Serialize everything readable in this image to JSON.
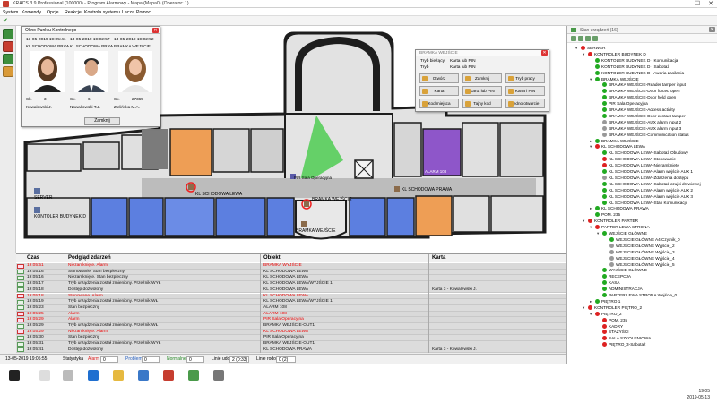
{
  "window": {
    "title": "KRACS 3.9 Professional (100000) - Program Alarmowy - Mapa (Mapa0) (Operator: 1)",
    "controls": [
      "—",
      "☐",
      "✕"
    ]
  },
  "menu": [
    "System",
    "Komendy",
    "Opcje",
    "Reakcje",
    "Kontrola systemu",
    "Lacza",
    "Pomoc"
  ],
  "map": {
    "labels": {
      "server": "SERVER",
      "controller_d": "KONTOLER BUDYNEK D",
      "left_wing": "KL SCHODOWA LEWA",
      "pir": "PIR Sala Operacyjna",
      "gate": "BRAMKA WEJŚCIE",
      "right_wing": "KL SCHODOWA PRAWA",
      "alarm_room": "ALARM 108"
    }
  },
  "checkpoint_window": {
    "title": "Okno Punktu Kontrolnego",
    "close_label": "Zamknij",
    "persons": [
      {
        "date": "13-05-2019 19:05:41",
        "object": "KL SCHODOWA PRAW",
        "sk": "Sk.",
        "sk_num": "3",
        "name": "Kowalewski J."
      },
      {
        "date": "13-05-2019 19:02:57",
        "object": "KL SCHODOWA PRAW",
        "sk": "Sk.",
        "sk_num": "6",
        "name": "Nowakowski T.J."
      },
      {
        "date": "13-05-2019 19:02:52",
        "object": "BRAMKA WEJSCIE",
        "sk": "Sk.",
        "sk_num": "27365",
        "name": "Zielińska M.A."
      }
    ]
  },
  "gate_window": {
    "title": "BRAMKA WEJŚCIE",
    "mode_label": "Tryb bieżący",
    "mode_value": "Karta lub PIN",
    "mode2_label": "Tryb",
    "mode2_value": "Karta lub PIN",
    "buttons": [
      "Otwórz",
      "Zamknij",
      "Tryb pracy",
      "Karta",
      "Karta lub PIN",
      "Karta i PIN",
      "Kod miejsca",
      "Tajny kod",
      "Jedno otwarcie"
    ]
  },
  "events": {
    "columns": {
      "time": "Czas",
      "event": "Podgląd zdarzeń",
      "object": "Obiekt",
      "card": "Karta"
    },
    "rows": [
      {
        "time": "19:05:51",
        "event": "Niezamknięte. Alarm",
        "object": "BRAMKA WYJŚCIE",
        "card": "",
        "kind": "alarm"
      },
      {
        "time": "19:05:16",
        "event": "Stonowanie. Stan bezpieczny",
        "object": "KL SCHODOWA LEWA",
        "card": "",
        "kind": "ok"
      },
      {
        "time": "19:05:16",
        "event": "Niezamknięte. Stan bezpieczny",
        "object": "KL SCHODOWA LEWA",
        "card": "",
        "kind": "ok"
      },
      {
        "time": "19:05:17",
        "event": "Tryb urządzenia został zmieniony. Przeżnik WYŁ",
        "object": "KL SCHODOWA LEWA/WYJŚCIE 1",
        "card": "",
        "kind": "ok"
      },
      {
        "time": "19:05:18",
        "event": "Dostęp dozwolony",
        "object": "KL SCHODOWA LEWA",
        "card": "Karta 3 - Kowalewski J.",
        "kind": "ok"
      },
      {
        "time": "19:05:18",
        "event": "Stonowane. Alarm",
        "object": "KL SCHODOWA LEWA",
        "card": "",
        "kind": "alarm"
      },
      {
        "time": "19:05:19",
        "event": "Tryb urządzenia został zmieniony. Przeżnik WŁ",
        "object": "KL SCHODOWA LEWA/WYJŚCIE 1",
        "card": "",
        "kind": "ok"
      },
      {
        "time": "19:05:23",
        "event": "Stan bezpieczny",
        "object": "ALARM 108",
        "card": "",
        "kind": "ok"
      },
      {
        "time": "19:05:25",
        "event": "Alarm",
        "object": "ALARM 108",
        "card": "",
        "kind": "alarm"
      },
      {
        "time": "19:05:29",
        "event": "Alarm",
        "object": "PIR Sala Operacyjna",
        "card": "",
        "kind": "alarm"
      },
      {
        "time": "19:05:29",
        "event": "Tryb urządzenia został zmieniony. Przeżnik WŁ",
        "object": "BRAMKA WEJŚCIE-OUT1",
        "card": "",
        "kind": "ok"
      },
      {
        "time": "19:05:29",
        "event": "Niezamknięte. Alarm",
        "object": "KL SCHODOWA LEWA",
        "card": "",
        "kind": "alarm"
      },
      {
        "time": "19:05:30",
        "event": "Stan bezpieczny",
        "object": "PIR Sala Operacyjna",
        "card": "",
        "kind": "ok"
      },
      {
        "time": "19:05:31",
        "event": "Tryb urządzenia został zmieniony. Przeżnik WYŁ",
        "object": "BRAMKA WEJŚCIE-OUT1",
        "card": "",
        "kind": "ok"
      },
      {
        "time": "19:05:41",
        "event": "Dostęp dozwolony",
        "object": "KL SCHODOWA PRAWA",
        "card": "Karta 3 - Kowalewski J.",
        "kind": "ok"
      }
    ]
  },
  "statusbar": {
    "datetime": "13-05-2019 19:05:55",
    "stat_label": "Statystyka",
    "alarm_label": "Alarm",
    "alarm_val": "0",
    "problem_label": "Problem",
    "problem_val": "0",
    "normal_label": "Normalne",
    "normal_val": "0",
    "line1_label": "Linie udo",
    "line1_val": "2 (0:33)",
    "line2_label": "Linie rodo",
    "line2_val": "0 (2)"
  },
  "tree": {
    "title": "Stan urządzeń (16)",
    "nodes": [
      {
        "label": "SERWER",
        "level": 0,
        "color": "#d22",
        "twisty": "▾"
      },
      {
        "label": "KONTROLER BUDYNEK D",
        "level": 1,
        "color": "#d22",
        "twisty": "▾"
      },
      {
        "label": "KONTOLER BUDYNEK D - Komunikacja",
        "level": 2,
        "color": "#2a2",
        "twisty": ""
      },
      {
        "label": "KONTOLER BUDYNEK D - Sabotaż",
        "level": 2,
        "color": "#2a2",
        "twisty": ""
      },
      {
        "label": "KONTOLER BUDYNEK D - Awaria zasilania",
        "level": 2,
        "color": "#2a2",
        "twisty": ""
      },
      {
        "label": "BRAMKA WEJŚCIE",
        "level": 2,
        "color": "#2a2",
        "twisty": "▾"
      },
      {
        "label": "BRAMKA WEJŚCIE-Reader tamper input",
        "level": 3,
        "color": "#2a2",
        "twisty": ""
      },
      {
        "label": "BRAMKA WEJŚCIE-Door forced open",
        "level": 3,
        "color": "#2a2",
        "twisty": ""
      },
      {
        "label": "BRAMKA WEJŚCIE-Door held open",
        "level": 3,
        "color": "#2a2",
        "twisty": ""
      },
      {
        "label": "PIR Sala Operacyjna",
        "level": 3,
        "color": "#2a2",
        "twisty": ""
      },
      {
        "label": "BRAMKA WEJŚCIE-Access activity",
        "level": 3,
        "color": "#2a2",
        "twisty": ""
      },
      {
        "label": "BRAMKA WEJŚCIE-Door contact tamper",
        "level": 3,
        "color": "#2a2",
        "twisty": ""
      },
      {
        "label": "BRAMKA WEJŚCIE-AUX alarm input 2",
        "level": 3,
        "color": "#999",
        "twisty": ""
      },
      {
        "label": "BRAMKA WEJŚCIE-AUX alarm input 3",
        "level": 3,
        "color": "#999",
        "twisty": ""
      },
      {
        "label": "BRAMKA WEJŚCIE-Communication status",
        "level": 3,
        "color": "#999",
        "twisty": ""
      },
      {
        "label": "BRAMKA WEJŚCIE",
        "level": 2,
        "color": "#2a2",
        "twisty": "▸"
      },
      {
        "label": "KL SCHODOWA LEWA",
        "level": 2,
        "color": "#d22",
        "twisty": "▾"
      },
      {
        "label": "KL SCHODOWA LEWA-Sabotaż Obudowy",
        "level": 3,
        "color": "#2a2",
        "twisty": ""
      },
      {
        "label": "KL SCHODOWA LEWA-Stonowanie",
        "level": 3,
        "color": "#d22",
        "twisty": ""
      },
      {
        "label": "KL SCHODOWA LEWA-Niezamknięte",
        "level": 3,
        "color": "#d22",
        "twisty": ""
      },
      {
        "label": "KL SCHODOWA LEWA-Alarm wejście AUX 1",
        "level": 3,
        "color": "#2a2",
        "twisty": ""
      },
      {
        "label": "KL SCHODOWA LEWA-Zdarzenia dostępu",
        "level": 3,
        "color": "#999",
        "twisty": ""
      },
      {
        "label": "KL SCHODOWA LEWA-Sabotaż czujki drzwiowej",
        "level": 3,
        "color": "#2a2",
        "twisty": ""
      },
      {
        "label": "KL SCHODOWA LEWA-Alarm wejście AUX 2",
        "level": 3,
        "color": "#2a2",
        "twisty": ""
      },
      {
        "label": "KL SCHODOWA LEWA-Alarm wejście AUX 3",
        "level": 3,
        "color": "#2a2",
        "twisty": ""
      },
      {
        "label": "KL SCHODOWA LEWA-Stan Komunikacji",
        "level": 3,
        "color": "#2a2",
        "twisty": ""
      },
      {
        "label": "KL SCHODOWA PRAWA",
        "level": 2,
        "color": "#2a2",
        "twisty": "▸"
      },
      {
        "label": "POM. 235",
        "level": 2,
        "color": "#2a2",
        "twisty": ""
      },
      {
        "label": "KONTROLER PARTER",
        "level": 1,
        "color": "#d22",
        "twisty": "▾"
      },
      {
        "label": "PARTER LEWA STRONA",
        "level": 2,
        "color": "#d22",
        "twisty": "▾"
      },
      {
        "label": "WEJŚCIE GŁÓWNE",
        "level": 3,
        "color": "#2a2",
        "twisty": "▾"
      },
      {
        "label": "WEJŚCIE GŁÓWNE A4 Czytnik_0",
        "level": 4,
        "color": "#2a2",
        "twisty": ""
      },
      {
        "label": "WEJŚCIE GŁÓWNE Wyjście_2",
        "level": 4,
        "color": "#999",
        "twisty": ""
      },
      {
        "label": "WEJŚCIE GŁÓWNE Wyjście_3",
        "level": 4,
        "color": "#999",
        "twisty": ""
      },
      {
        "label": "WEJŚCIE GŁÓWNE Wyjście_4",
        "level": 4,
        "color": "#999",
        "twisty": ""
      },
      {
        "label": "WEJŚCIE GŁÓWNE Wyjście_5",
        "level": 4,
        "color": "#999",
        "twisty": ""
      },
      {
        "label": "WYJŚCIE GŁÓWNE",
        "level": 3,
        "color": "#2a2",
        "twisty": ""
      },
      {
        "label": "RECEPCJA",
        "level": 3,
        "color": "#2a2",
        "twisty": ""
      },
      {
        "label": "KASA",
        "level": 3,
        "color": "#2a2",
        "twisty": ""
      },
      {
        "label": "ADMINISTRACJA",
        "level": 3,
        "color": "#2a2",
        "twisty": ""
      },
      {
        "label": "PARTER LEWA STRONA Wejście_0",
        "level": 3,
        "color": "#2a2",
        "twisty": ""
      },
      {
        "label": "PIĘTRO 1",
        "level": 2,
        "color": "#2a2",
        "twisty": "▸"
      },
      {
        "label": "KONTROLER PIĘTRO_2",
        "level": 1,
        "color": "#d22",
        "twisty": "▾"
      },
      {
        "label": "PIĘTRO_2",
        "level": 2,
        "color": "#d22",
        "twisty": "▾"
      },
      {
        "label": "POM. 235",
        "level": 3,
        "color": "#d22",
        "twisty": ""
      },
      {
        "label": "KADRY",
        "level": 3,
        "color": "#d22",
        "twisty": ""
      },
      {
        "label": "STAŻYŚCI",
        "level": 3,
        "color": "#d22",
        "twisty": ""
      },
      {
        "label": "SALA SZKOLENIOWA",
        "level": 3,
        "color": "#d22",
        "twisty": ""
      },
      {
        "label": "PIĘTRO_3-Sabotaż",
        "level": 3,
        "color": "#d22",
        "twisty": ""
      }
    ]
  },
  "taskbar": {
    "time": "19:05",
    "date": "2019-05-13"
  },
  "colors": {
    "orange_room": "#ee9e55",
    "blue_room": "#5c7fe0",
    "purple_room": "#8e56c9",
    "wall": "#202020",
    "corridor": "#b8b8b8",
    "stair": "#7c7c7c"
  }
}
